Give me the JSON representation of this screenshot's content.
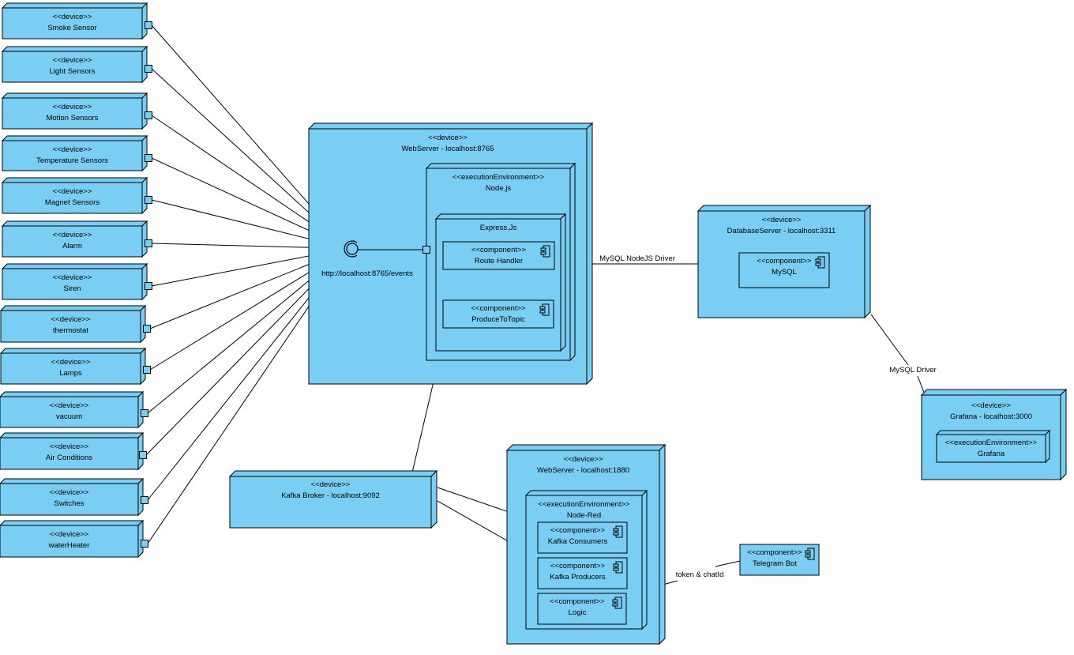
{
  "colors": {
    "fill": "#7acef4",
    "stroke": "#000000",
    "background": "#ffffff"
  },
  "sensors": [
    {
      "stereotype": "<<device>>",
      "name": "Smoke Sensor"
    },
    {
      "stereotype": "<<device>>",
      "name": "Light Sensors"
    },
    {
      "stereotype": "<<device>>",
      "name": "Motion Sensors"
    },
    {
      "stereotype": "<<device>>",
      "name": "Temperature Sensors"
    },
    {
      "stereotype": "<<device>>",
      "name": "Magnet Sensors"
    },
    {
      "stereotype": "<<device>>",
      "name": "Alarm"
    },
    {
      "stereotype": "<<device>>",
      "name": "Siren"
    },
    {
      "stereotype": "<<device>>",
      "name": "thermostat"
    },
    {
      "stereotype": "<<device>>",
      "name": "Lamps"
    },
    {
      "stereotype": "<<device>>",
      "name": "vacuum"
    },
    {
      "stereotype": "<<device>>",
      "name": "Air Conditions"
    },
    {
      "stereotype": "<<device>>",
      "name": "Switches"
    },
    {
      "stereotype": "<<device>>",
      "name": "waterHeater"
    }
  ],
  "webserver_main": {
    "stereotype": "<<device>>",
    "name": "WebServer - localhost:8765"
  },
  "nodejs": {
    "stereotype": "<<executionEnvironment>>",
    "name": "Node.js"
  },
  "express": {
    "name": "Express.Js"
  },
  "route_handler": {
    "stereotype": "<<component>>",
    "name": "Route Handler"
  },
  "produce_to_topic": {
    "stereotype": "<<component>>",
    "name": "ProduceToTopic"
  },
  "interface_label": "http://localhost:8765/events",
  "db_server": {
    "stereotype": "<<device>>",
    "name": "DatabaseServer - localhost:3311"
  },
  "mysql": {
    "stereotype": "<<component>>",
    "name": "MySQL"
  },
  "grafana_device": {
    "stereotype": "<<device>>",
    "name": "Grafana - localhost:3000"
  },
  "grafana_env": {
    "stereotype": "<<executionEnvironment>>",
    "name": "Grafana"
  },
  "kafka_broker": {
    "stereotype": "<<device>>",
    "name": "Kafka Broker - localhost:9092"
  },
  "webserver_nodered": {
    "stereotype": "<<device>>",
    "name": "WebServer - localhost:1880"
  },
  "nodered": {
    "stereotype": "<<executionEnvironment>>",
    "name": "Node-Red"
  },
  "kafka_consumers": {
    "stereotype": "<<component>>",
    "name": "Kafka Consumers"
  },
  "kafka_producers": {
    "stereotype": "<<component>>",
    "name": "Kafka Producers"
  },
  "logic": {
    "stereotype": "<<component>>",
    "name": "Logic"
  },
  "telegram_bot": {
    "stereotype": "<<component>>",
    "name": "Telegram Bot"
  },
  "connectors": {
    "nodejs_db": "MySQL NodeJS Driver",
    "db_grafana": "MySQL Driver",
    "logic_telegram": "token & chatId"
  }
}
